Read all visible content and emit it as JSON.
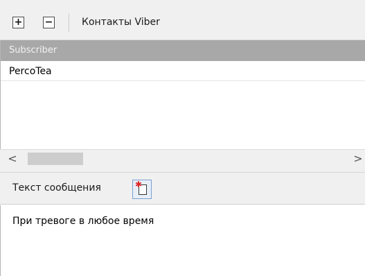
{
  "toolbar": {
    "add_icon": "plus-box-icon",
    "remove_icon": "minus-box-icon",
    "title": "Контакты Viber"
  },
  "contacts_list": {
    "column_header": "Subscriber",
    "rows": [
      "PercoTea"
    ]
  },
  "scrollbar": {
    "left_arrow": "<",
    "right_arrow": ">"
  },
  "message": {
    "label": "Текст сообщения",
    "template_icon": "insert-template-icon",
    "text": "При тревоге в любое время"
  },
  "colors": {
    "header_bg": "#a8a8a8",
    "toolbar_bg": "#f0f0f0"
  }
}
